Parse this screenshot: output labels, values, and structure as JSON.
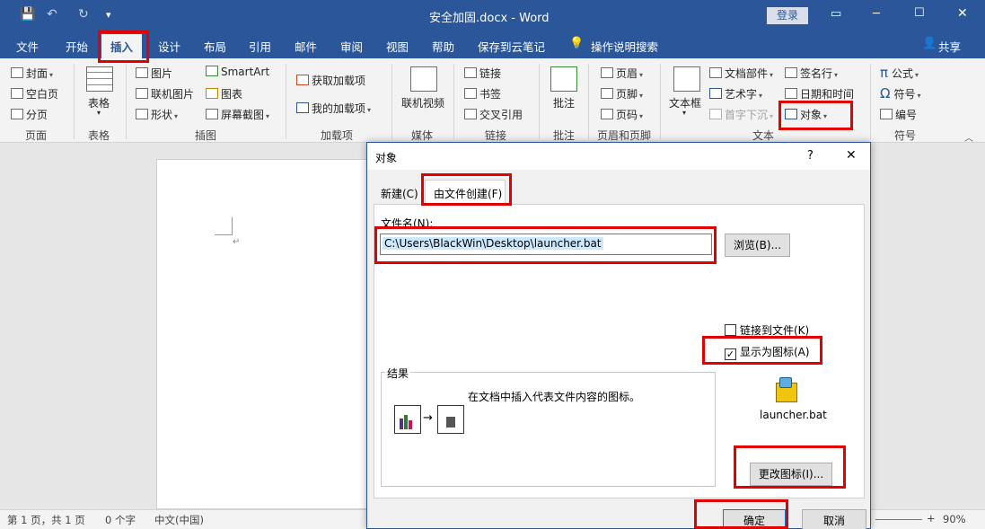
{
  "window": {
    "title": "安全加固.docx - Word",
    "login": "登录",
    "controls": [
      "▭",
      "─",
      "☐",
      "✕"
    ]
  },
  "qat": {
    "save": "💾",
    "undo": "↶",
    "redo": "↻",
    "more": "▾"
  },
  "tabs": [
    "文件",
    "开始",
    "插入",
    "设计",
    "布局",
    "引用",
    "邮件",
    "审阅",
    "视图",
    "帮助",
    "保存到云笔记",
    "操作说明搜索"
  ],
  "share": "共享",
  "ribbon": {
    "pages": {
      "items": [
        "封面",
        "空白页",
        "分页"
      ],
      "label": "页面"
    },
    "tables": {
      "item": "表格",
      "label": "表格"
    },
    "illustrations": {
      "items": [
        "图片",
        "联机图片",
        "形状",
        "SmartArt",
        "图表",
        "屏幕截图"
      ],
      "label": "插图"
    },
    "addins": {
      "items": [
        "获取加载项",
        "我的加载项"
      ],
      "label": "加载项"
    },
    "media": {
      "item": "联机视频",
      "label": "媒体"
    },
    "links": {
      "items": [
        "链接",
        "书签",
        "交叉引用"
      ],
      "label": "链接"
    },
    "comments": {
      "item": "批注",
      "label": "批注"
    },
    "headerfooter": {
      "items": [
        "页眉",
        "页脚",
        "页码"
      ],
      "label": "页眉和页脚"
    },
    "text": {
      "items": [
        "文本框",
        "文档部件",
        "艺术字",
        "首字下沉",
        "签名行",
        "日期和时间",
        "对象"
      ],
      "label": "文本"
    },
    "symbols": {
      "items": [
        "公式",
        "符号",
        "编号"
      ],
      "label": "符号"
    }
  },
  "dialog": {
    "title": "对象",
    "help": "?",
    "close": "✕",
    "tab_new": "新建(C)",
    "tab_fromfile": "由文件创建(F)",
    "filename_label": "文件名(N):",
    "filename_value": "C:\\Users\\BlackWin\\Desktop\\launcher.bat",
    "browse": "浏览(B)...",
    "link_to_file": "链接到文件(K)",
    "display_as_icon": "显示为图标(A)",
    "result_label": "结果",
    "result_text": "在文档中插入代表文件内容的图标。",
    "icon_caption": "launcher.bat",
    "change_icon": "更改图标(I)...",
    "ok": "确定",
    "cancel": "取消"
  },
  "status": {
    "page": "第 1 页，共 1 页",
    "words": "0 个字",
    "lang": "中文(中国)",
    "zoom": "90%"
  },
  "colors": {
    "brand": "#2b579a",
    "highlight": "#e30000",
    "selection": "#cce8ff"
  }
}
